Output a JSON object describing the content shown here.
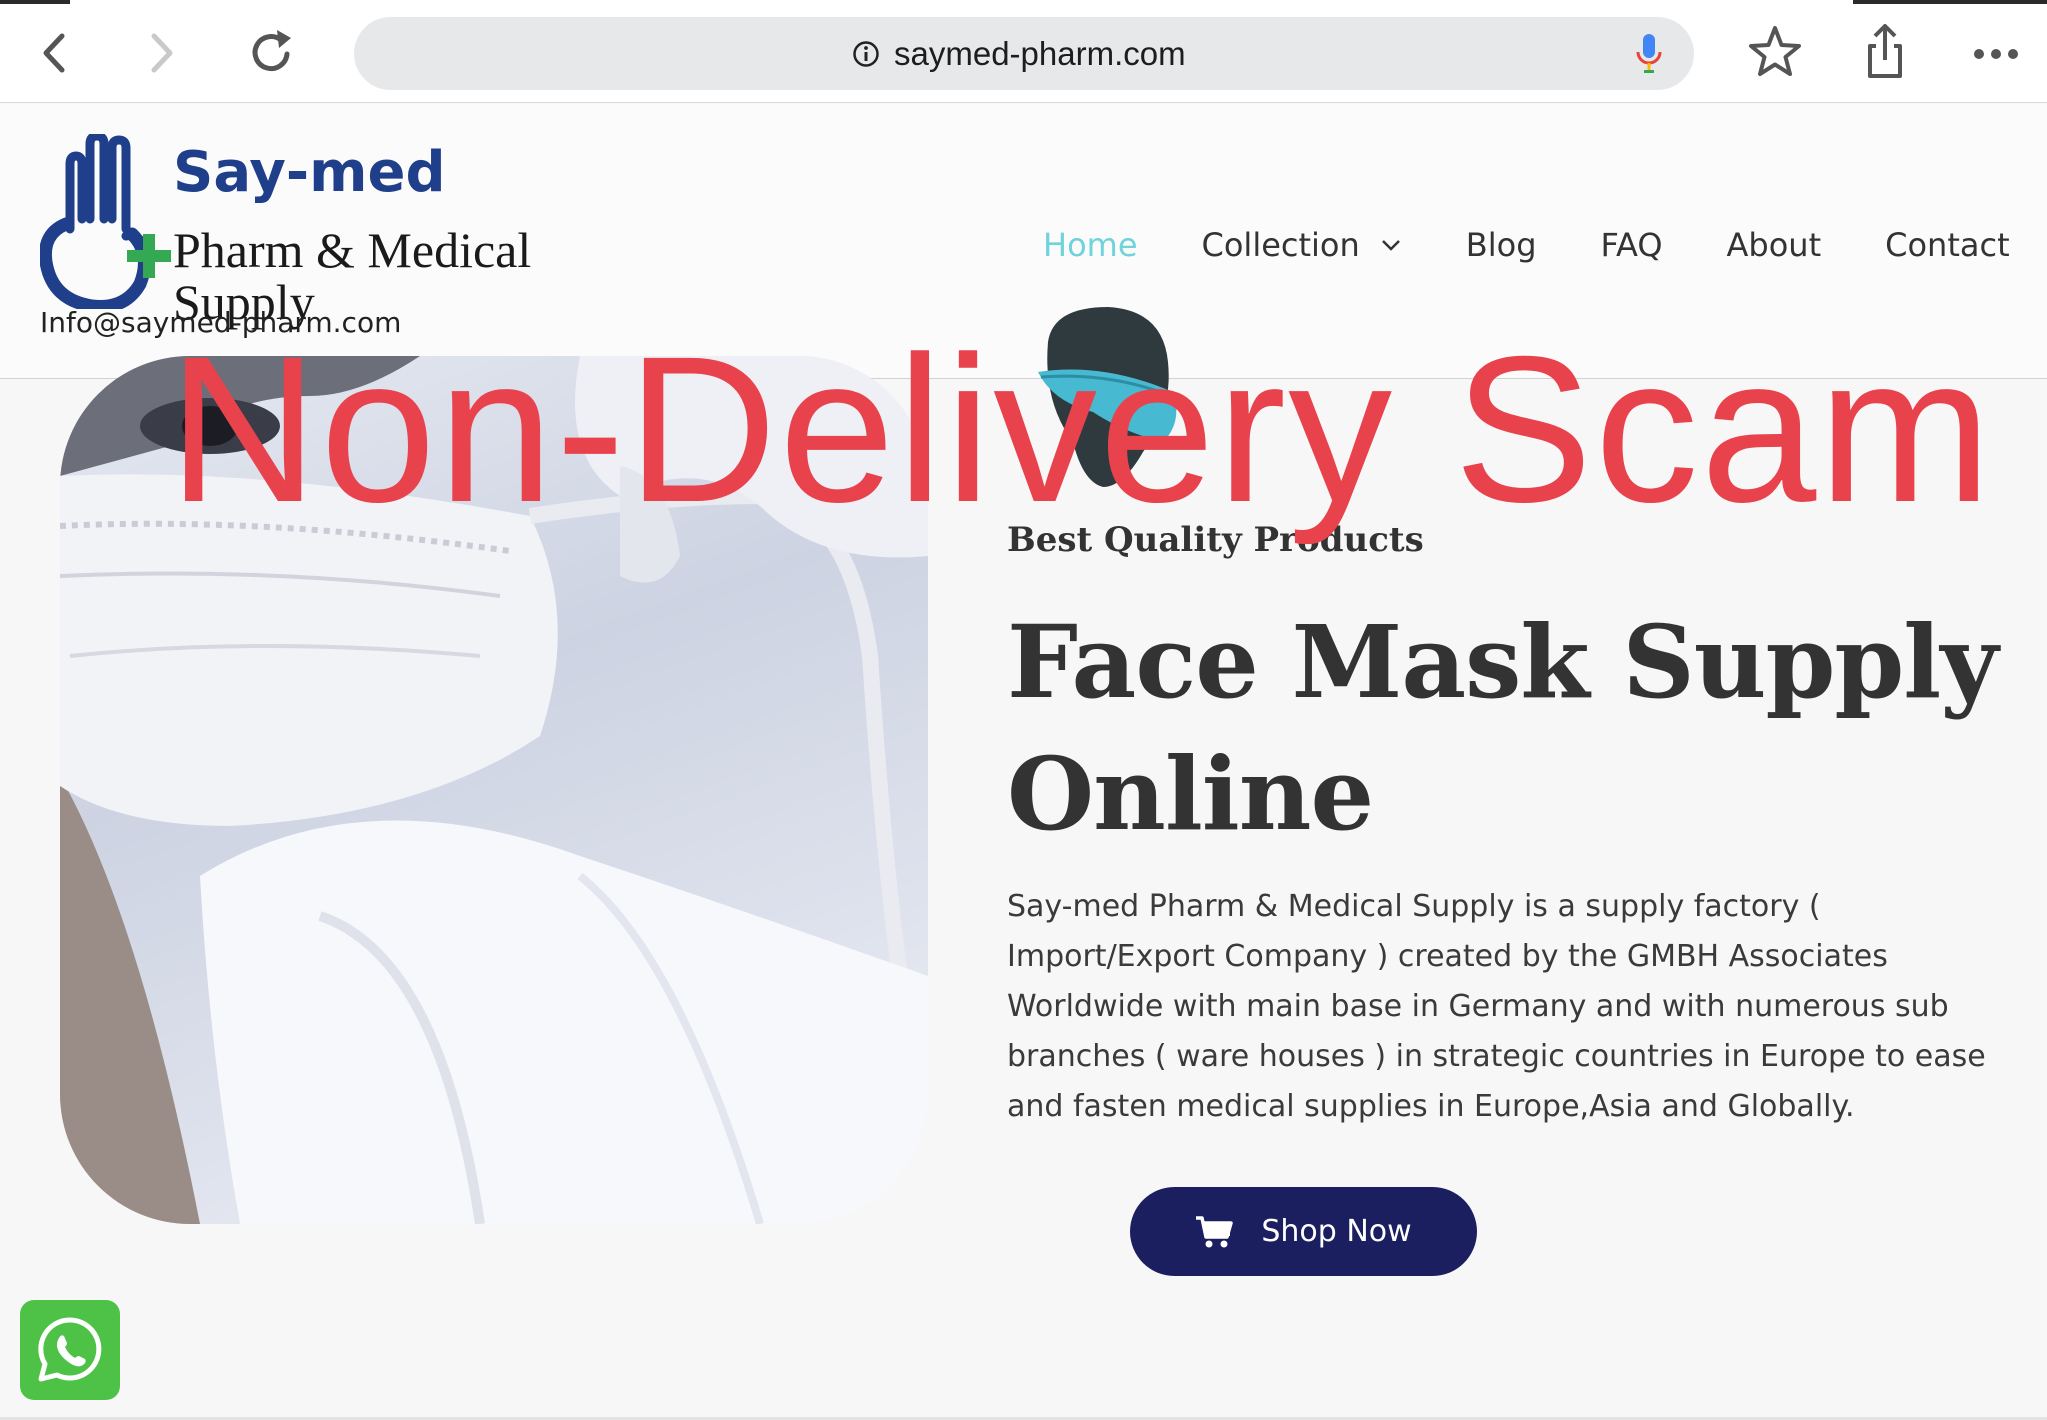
{
  "browser": {
    "url": "saymed-pharm.com",
    "icons": {
      "back": "chevron-left-icon",
      "forward": "chevron-right-icon",
      "reload": "reload-icon",
      "site_info": "info-icon",
      "voice": "microphone-icon",
      "bookmark": "star-icon",
      "share": "share-icon",
      "more": "more-dots-icon"
    }
  },
  "site": {
    "logo": {
      "name": "Say-med",
      "line1": "Pharm & Medical",
      "line2": "Supply",
      "colors": {
        "brand_blue": "#1f3f8a",
        "cross_green": "#34a853"
      }
    },
    "email": "Info@saymed-pharm.com",
    "nav": [
      {
        "label": "Home",
        "active": true
      },
      {
        "label": "Collection",
        "dropdown": true
      },
      {
        "label": "Blog"
      },
      {
        "label": "FAQ"
      },
      {
        "label": "About"
      },
      {
        "label": "Contact"
      }
    ],
    "colors": {
      "nav_active": "#6fd3db",
      "button_bg": "#1b1f5f"
    }
  },
  "hero": {
    "eyebrow": "Best Quality Products",
    "headline_line1": "Face Mask Supply",
    "headline_line2": "Online",
    "description": "Say-med Pharm & Medical Supply is a supply factory ( Import/Export Company ) created by the GMBH Associates Worldwide with main base in Germany and with numerous sub branches ( ware houses ) in strategic countries in Europe to ease and fasten medical supplies in Europe,Asia and Globally.",
    "button_label": "Shop Now",
    "button_icon": "cart-icon",
    "image_icon": "face-mask-photo"
  },
  "overlay": {
    "text": "Non-Delivery Scam",
    "color": "#e8434d"
  },
  "floating": {
    "whatsapp_icon": "whatsapp-icon",
    "color": "#4dc247"
  }
}
